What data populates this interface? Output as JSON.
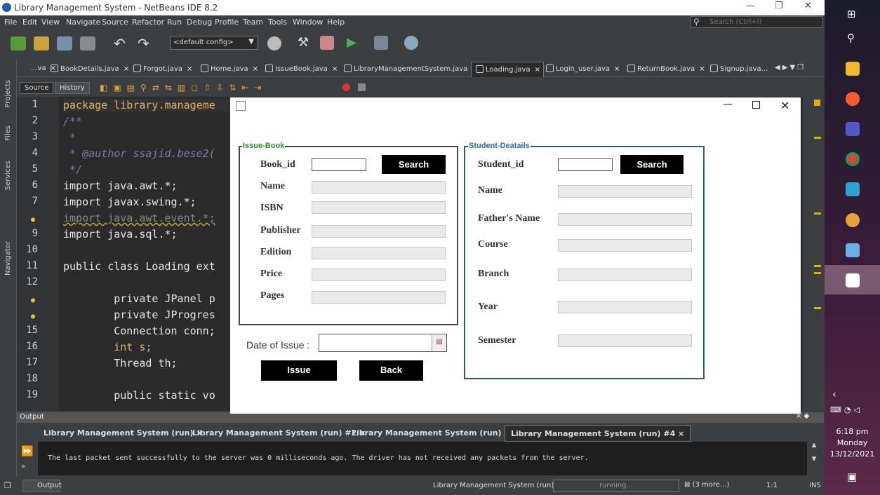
{
  "window": {
    "title": "Library Management System - NetBeans IDE 8.2"
  },
  "menu": [
    "File",
    "Edit",
    "View",
    "Navigate",
    "Source",
    "Refactor",
    "Run",
    "Debug",
    "Profile",
    "Team",
    "Tools",
    "Window",
    "Help"
  ],
  "search": {
    "placeholder": "Search (Ctrl+I)"
  },
  "toolbar": {
    "config": "<default config>"
  },
  "tabs": [
    "...va",
    "BookDetails.java",
    "Forgot.java",
    "Home.java",
    "IssueBook.java",
    "LibraryManagementSystem.java",
    "Loading.java",
    "Login_user.java",
    "ReturnBook.java",
    "Signup.java..."
  ],
  "active_tab": "Loading.java",
  "editor": {
    "source_label": "Source",
    "history_label": "History"
  },
  "side_labels": {
    "projects": "Projects",
    "files": "Files",
    "services": "Services",
    "navigator": "Navigator"
  },
  "lines": [
    {
      "n": "1",
      "t": "package library.manageme"
    },
    {
      "n": "2",
      "t": "/**"
    },
    {
      "n": "3",
      "t": " *"
    },
    {
      "n": "4",
      "t": " * @author ssajid.bese2("
    },
    {
      "n": "5",
      "t": " */"
    },
    {
      "n": "6",
      "t": "import java.awt.*;"
    },
    {
      "n": "7",
      "t": "import javax.swing.*;"
    },
    {
      "n": "8",
      "t": "import java.awt.event.*;"
    },
    {
      "n": "9",
      "t": "import java.sql.*;"
    },
    {
      "n": "10",
      "t": ""
    },
    {
      "n": "11",
      "t": "public class Loading ext"
    },
    {
      "n": "12",
      "t": ""
    },
    {
      "n": "13",
      "t": "        private JPanel p"
    },
    {
      "n": "14",
      "t": "        private JProgres"
    },
    {
      "n": "15",
      "t": "        Connection conn;"
    },
    {
      "n": "16",
      "t": "        int s;"
    },
    {
      "n": "17",
      "t": "        Thread th;"
    },
    {
      "n": "18",
      "t": ""
    },
    {
      "n": "19",
      "t": "        public static vo"
    }
  ],
  "output": {
    "header": "Output",
    "tabs": [
      "Library Management System (run)",
      "Library Management System (run) #2",
      "Library Management System (run) #3",
      "Library Management System (run) #4"
    ],
    "message": "The last packet sent successfully to the server was 0 milliseconds ago. The driver has not received any packets from the server."
  },
  "status": {
    "output_btn": "Output",
    "run_label": "Library Management System (run) #4",
    "progress": "running...",
    "more": "(3 more...)",
    "position": "1:1",
    "mode": "INS"
  },
  "dialog": {
    "issue_book": {
      "legend": "Issue-Book",
      "book_id_label": "Book_id",
      "search_label": "Search",
      "fields": [
        "Name",
        "ISBN",
        "Publisher",
        "Edition",
        "Price",
        "Pages"
      ]
    },
    "student": {
      "legend": "Student-Deatails",
      "id_label": "Student_id",
      "search_label": "Search",
      "fields": [
        "Name",
        "Father's Name",
        "Course",
        "Branch",
        "Year",
        "Semester"
      ]
    },
    "date_label": "Date of Issue :",
    "issue_btn": "Issue",
    "back_btn": "Back"
  },
  "clock": {
    "time": "6:18 pm",
    "day": "Monday",
    "date": "13/12/2021"
  },
  "colors": {
    "ide_bg": "#3c3f41",
    "editor_bg": "#2b2b2b",
    "legend_green": "#2e8b2e",
    "legend_blue": "#2a6fbf"
  }
}
